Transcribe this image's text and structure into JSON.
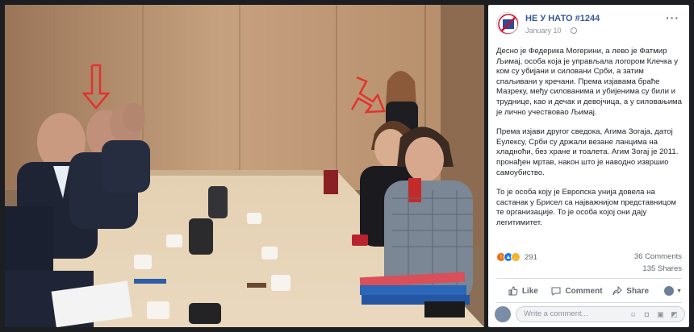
{
  "post": {
    "page_name": "НЕ У НАТО #1244",
    "timestamp": "January 10",
    "more_icon": "more-options-icon",
    "paragraphs": [
      "Десно је Федерика Могерини, а лево је Фатмир Љимај, особа која је управљала логором Клечка у ком су убијани и силовани Срби, а затим спаљивани у кречани. Према изјавама браће Мазреку, међу силованима и убијенима су били и труднице, као и дечак и девојчица, а у силовањима је лично учествовао Љимај.",
      "Према изјави другог сведока, Агима Зогаја, датој Еулексу, Срби су држали везане ланцима на хладноћи, без хране и тоалета. Агим Зогај је 2011. пронађен мртав, након што је наводно извршио самоубиство.",
      "То је особа коју је Европска унија довела на састанак у Брисел са најважнијом представницом те организације. То је особа којој они дају легитимитет."
    ],
    "reactions": {
      "icons": [
        "angry-reaction-icon",
        "like-reaction-icon",
        "sad-reaction-icon"
      ],
      "count": "291",
      "comments": "36 Comments",
      "shares": "135 Shares"
    },
    "actions": {
      "like": "Like",
      "comment": "Comment",
      "share": "Share"
    },
    "comment_box": {
      "placeholder": "Write a comment..."
    }
  },
  "photo": {
    "description_icon": "meeting-photo"
  },
  "colors": {
    "background": "#1c1e21",
    "page_name": "#385898",
    "arrow": "#e0332d",
    "wall": "#c9a37f",
    "table": "#e7d3b5"
  }
}
